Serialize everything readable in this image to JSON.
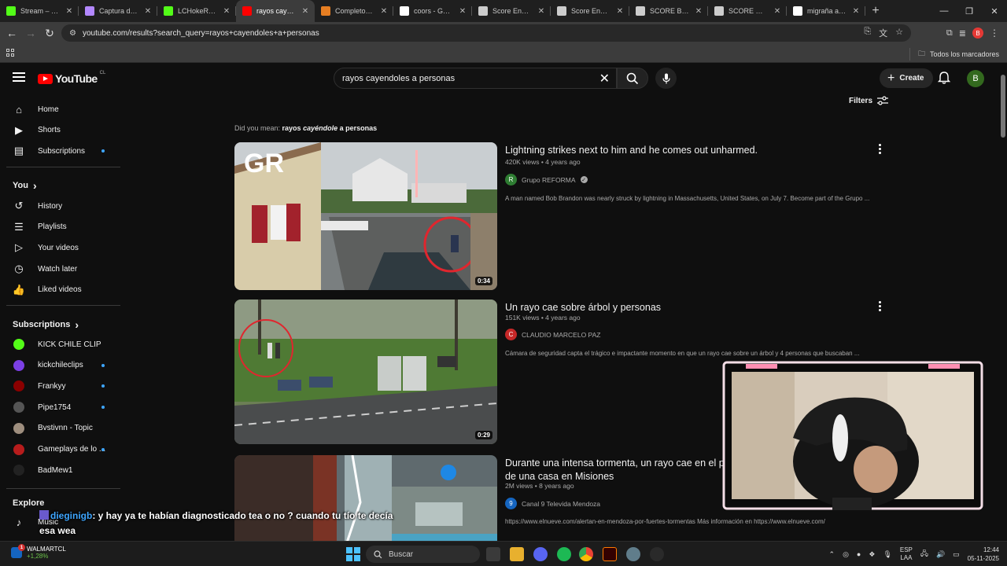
{
  "browser": {
    "tabs": [
      {
        "label": "Stream – Kick D",
        "favicon": "kick-icon",
        "color": "#53fc18",
        "active": false
      },
      {
        "label": "Captura de pan",
        "favicon": "pen-icon",
        "color": "#b388ff",
        "active": false
      },
      {
        "label": "LCHokeRap Stre",
        "favicon": "kick-icon",
        "color": "#53fc18",
        "active": false
      },
      {
        "label": "rayos cayendol",
        "favicon": "youtube-icon",
        "color": "#ff0000",
        "active": true
      },
      {
        "label": "Completos Var",
        "favicon": "recipe-icon",
        "color": "#e67e22",
        "active": false
      },
      {
        "label": "coors - Google",
        "favicon": "google-icon",
        "color": "#ffffff",
        "active": false
      },
      {
        "label": "Score Energy D",
        "favicon": "web-icon",
        "color": "#cccccc",
        "active": false
      },
      {
        "label": "Score Energy D",
        "favicon": "web-icon",
        "color": "#cccccc",
        "active": false
      },
      {
        "label": "SCORE BUBBLE",
        "favicon": "web-icon",
        "color": "#cccccc",
        "active": false
      },
      {
        "label": "SCORE GORILL",
        "favicon": "web-icon",
        "color": "#cccccc",
        "active": false
      },
      {
        "label": "migraña aura",
        "favicon": "google-icon",
        "color": "#ffffff",
        "active": false
      }
    ],
    "url": "youtube.com/results?search_query=rayos+cayendoles+a+personas",
    "all_bookmarks": "Todos los marcadores",
    "profile_initial": "B"
  },
  "youtube": {
    "logo_text": "YouTube",
    "country_code": "CL",
    "search_query": "rayos cayendoles a personas",
    "create_label": "Create",
    "avatar_initial": "B",
    "filters_label": "Filters"
  },
  "sidebar": {
    "main": [
      {
        "label": "Home",
        "icon": "home-icon"
      },
      {
        "label": "Shorts",
        "icon": "shorts-icon"
      },
      {
        "label": "Subscriptions",
        "icon": "subscriptions-icon"
      }
    ],
    "you_heading": "You",
    "you": [
      {
        "label": "History",
        "icon": "history-icon"
      },
      {
        "label": "Playlists",
        "icon": "playlists-icon"
      },
      {
        "label": "Your videos",
        "icon": "your-videos-icon"
      },
      {
        "label": "Watch later",
        "icon": "watch-later-icon"
      },
      {
        "label": "Liked videos",
        "icon": "like-icon"
      }
    ],
    "subs_heading": "Subscriptions",
    "subscriptions": [
      {
        "label": "KICK CHILE CLIP",
        "color": "#53fc18",
        "dot": false
      },
      {
        "label": "kickchileclips",
        "color": "#7b3fe4",
        "dot": true
      },
      {
        "label": "Frankyy",
        "color": "#8b0000",
        "dot": true
      },
      {
        "label": "Pipe1754",
        "color": "#555555",
        "dot": true
      },
      {
        "label": "Bvstivnn - Topic",
        "color": "#9e8e7e",
        "dot": false
      },
      {
        "label": "Gameplays de lo ...",
        "color": "#b71c1c",
        "dot": true
      },
      {
        "label": "BadMew1",
        "color": "#222222",
        "dot": false
      }
    ],
    "explore_heading": "Explore",
    "explore": [
      {
        "label": "Music",
        "icon": "music-icon"
      }
    ]
  },
  "results": {
    "did_you_mean_prefix": "Did you mean:",
    "did_you_mean_a": "rayos",
    "did_you_mean_b": "cayéndole",
    "did_you_mean_c": "a personas",
    "items": [
      {
        "title": "Lightning strikes next to him and he comes out unharmed.",
        "meta": "420K views • 4 years ago",
        "channel": "Grupo REFORMA",
        "channel_color": "#2e7d32",
        "channel_initial": "R",
        "verified": true,
        "desc": "A man named Bob Brandon was nearly struck by lightning in Massachusetts, United States, on July 7. Become part of the Grupo ...",
        "duration": "0:34",
        "thumb_text": "GR"
      },
      {
        "title": "Un rayo cae sobre árbol y personas",
        "meta": "151K views • 4 years ago",
        "channel": "CLAUDIO MARCELO PAZ",
        "channel_color": "#c62828",
        "channel_initial": "C",
        "verified": false,
        "desc": "Cámara de seguridad capta el trágico e impactante momento en que un rayo cae sobre un árbol y 4 personas que buscaban ...",
        "duration": "0:29"
      },
      {
        "title": "Durante una intensa tormenta, un rayo cae en el patio de una casa en Misiones",
        "meta": "2M views • 8 years ago",
        "channel": "Canal 9 Televida Mendoza",
        "channel_color": "#1565c0",
        "channel_initial": "9",
        "verified": false,
        "desc": "https://www.elnueve.com/alertan-en-mendoza-por-fuertes-tormentas Más información en https://www.elnueve.com/"
      }
    ]
  },
  "chat": {
    "user": "dieginigb",
    "message": ": y hay ya te habían diagnosticado tea o no ? cuando tu tío te decía esa wea"
  },
  "taskbar": {
    "stock_name": "WALMARTCL",
    "stock_change": "+1,28%",
    "stock_badge": "1",
    "search_placeholder": "Buscar",
    "lang_1": "ESP",
    "lang_2": "LAA",
    "time": "12:44",
    "date": "05-11-2025"
  }
}
